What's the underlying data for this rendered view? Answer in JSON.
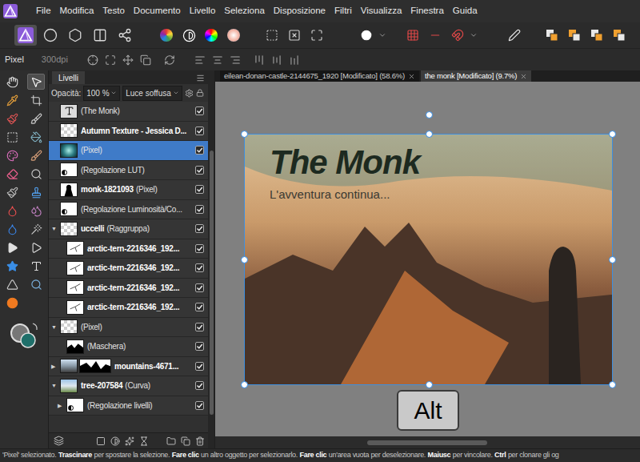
{
  "menu": [
    "File",
    "Modifica",
    "Testo",
    "Documento",
    "Livello",
    "Seleziona",
    "Disposizione",
    "Filtri",
    "Visualizza",
    "Finestra",
    "Guida"
  ],
  "personas": [
    {
      "selected": true
    },
    {
      "selected": false
    },
    {
      "selected": false
    },
    {
      "selected": false
    },
    {
      "selected": false
    }
  ],
  "context_bar": {
    "layer_type": "Pixel",
    "dpi": "300dpi"
  },
  "tools": [
    {
      "selected": false
    },
    {
      "selected": true
    },
    {
      "selected": false
    },
    {
      "selected": false
    },
    {
      "selected": false
    },
    {
      "selected": false
    },
    {
      "selected": false
    },
    {
      "selected": false
    },
    {
      "selected": false
    },
    {
      "selected": false
    },
    {
      "selected": false
    },
    {
      "selected": false
    },
    {
      "selected": false
    },
    {
      "selected": false
    },
    {
      "selected": false
    },
    {
      "selected": false
    },
    {
      "selected": false
    },
    {
      "selected": false
    },
    {
      "selected": false
    },
    {
      "selected": false
    },
    {
      "selected": false
    },
    {
      "selected": false
    },
    {
      "selected": false
    },
    {
      "selected": false
    },
    {
      "selected": false
    }
  ],
  "layers_panel": {
    "tab": "Livelli",
    "opacity_label": "Opacità:",
    "opacity": "100 %",
    "blend_mode": "Luce soffusa",
    "layers": [
      {
        "name": "(The Monk)",
        "detail": "",
        "bold": false,
        "kind": "text",
        "expander": "",
        "child": false,
        "selected": false,
        "visible": true
      },
      {
        "name": "Autumn Texture - Jessica D...",
        "detail": "",
        "bold": true,
        "kind": "checker",
        "expander": "",
        "child": false,
        "selected": false,
        "visible": true
      },
      {
        "name": "(Pixel)",
        "detail": "",
        "bold": false,
        "kind": "teal",
        "expander": "",
        "child": false,
        "selected": true,
        "visible": true
      },
      {
        "name": "(Regolazione LUT)",
        "detail": "",
        "bold": false,
        "kind": "adjustment",
        "expander": "",
        "child": false,
        "selected": false,
        "visible": true
      },
      {
        "name": "monk-1821093",
        "detail": "(Pixel)",
        "bold": true,
        "kind": "silhouette",
        "expander": "",
        "child": false,
        "selected": false,
        "visible": true
      },
      {
        "name": "(Regolazione Luminosità/Co...",
        "detail": "",
        "bold": false,
        "kind": "adjustment",
        "expander": "",
        "child": false,
        "selected": false,
        "visible": true
      },
      {
        "name": "uccelli",
        "detail": "(Raggruppa)",
        "bold": true,
        "kind": "checker",
        "expander": "▼",
        "child": false,
        "selected": false,
        "visible": true
      },
      {
        "name": "arctic-tern-2216346_192...",
        "detail": "",
        "bold": true,
        "kind": "bird",
        "expander": "",
        "child": true,
        "selected": false,
        "visible": true
      },
      {
        "name": "arctic-tern-2216346_192...",
        "detail": "",
        "bold": true,
        "kind": "bird",
        "expander": "",
        "child": true,
        "selected": false,
        "visible": true
      },
      {
        "name": "arctic-tern-2216346_192...",
        "detail": "",
        "bold": true,
        "kind": "bird",
        "expander": "",
        "child": true,
        "selected": false,
        "visible": true
      },
      {
        "name": "arctic-tern-2216346_192...",
        "detail": "",
        "bold": true,
        "kind": "bird",
        "expander": "",
        "child": true,
        "selected": false,
        "visible": true
      },
      {
        "name": "(Pixel)",
        "detail": "",
        "bold": false,
        "kind": "checker",
        "expander": "▼",
        "child": false,
        "selected": false,
        "visible": true
      },
      {
        "name": "(Maschera)",
        "detail": "",
        "bold": false,
        "kind": "mask",
        "expander": "",
        "child": true,
        "selected": false,
        "visible": true
      },
      {
        "name": "mountains-4671...",
        "detail": "",
        "bold": true,
        "kind": "mountains",
        "expander": "▶",
        "child": false,
        "selected": false,
        "visible": true
      },
      {
        "name": "tree-207584",
        "detail": "(Curva)",
        "bold": true,
        "kind": "tree",
        "expander": "▼",
        "child": false,
        "selected": false,
        "visible": true
      },
      {
        "name": "(Regolazione livelli)",
        "detail": "",
        "bold": false,
        "kind": "adjustment",
        "expander": "▶",
        "child": true,
        "selected": false,
        "visible": true
      }
    ]
  },
  "document_tabs": [
    {
      "label": "eilean-donan-castle-2144675_1920 [Modificato] (58.6%)",
      "selected": false
    },
    {
      "label": "the monk [Modificato] (9.7%)",
      "selected": true
    }
  ],
  "canvas": {
    "title": "The Monk",
    "subtitle": "L'avventura continua..."
  },
  "key_overlay": {
    "label": "Alt"
  },
  "status_bar": [
    {
      "text": "'Pixel' selezionato.",
      "bold": false
    },
    {
      "text": "Trascinare",
      "bold": true
    },
    {
      "text": "per spostare la selezione.",
      "bold": false
    },
    {
      "text": "Fare clic",
      "bold": true
    },
    {
      "text": "un altro oggetto per selezionarlo.",
      "bold": false
    },
    {
      "text": "Fare clic",
      "bold": true
    },
    {
      "text": "un'area vuota per deselezionare.",
      "bold": false
    },
    {
      "text": "Maiusc",
      "bold": true
    },
    {
      "text": "per vincolare.",
      "bold": false
    },
    {
      "text": "Ctrl",
      "bold": true
    },
    {
      "text": "per clonare gli og",
      "bold": false
    }
  ]
}
